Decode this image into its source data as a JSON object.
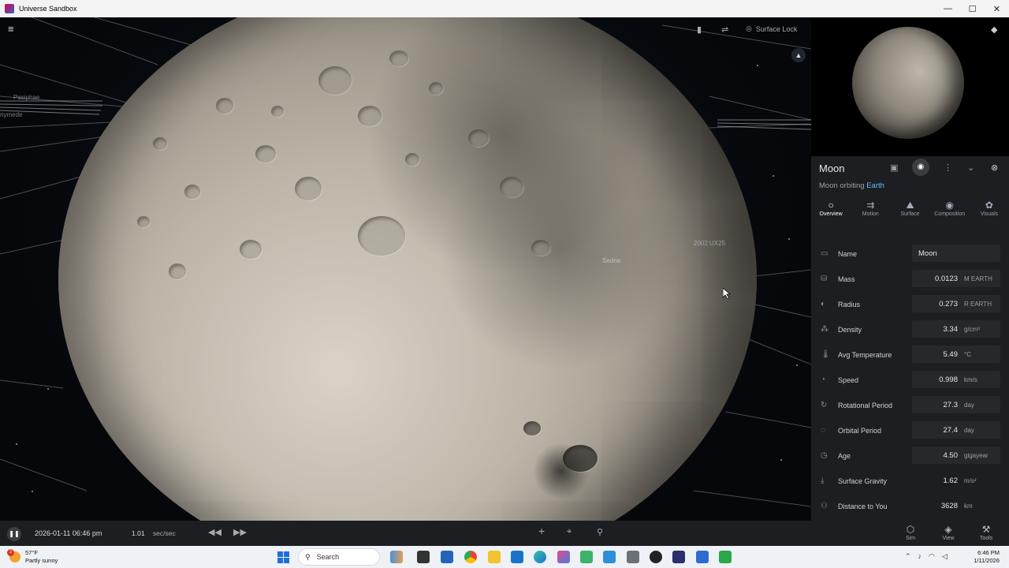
{
  "window": {
    "title": "Universe Sandbox",
    "controls": [
      "—",
      "☐",
      "✕"
    ]
  },
  "viewport": {
    "labels": [
      {
        "id": "pasiphae",
        "text": "Pasiphae"
      },
      {
        "id": "ganymede",
        "text": "nymede"
      },
      {
        "id": "sedna",
        "text": "Sedna"
      },
      {
        "id": "label-2002",
        "text": "2002 UX25"
      }
    ]
  },
  "toolbar": {
    "surface_lock_label": "Surface Lock"
  },
  "panel": {
    "object_name": "Moon",
    "orbiting_prefix": "Moon orbiting",
    "orbiting_target": "Earth",
    "tabs": [
      {
        "label": "Overview",
        "icon": "circle-icon",
        "glyph": "○"
      },
      {
        "label": "Motion",
        "icon": "motion-icon",
        "glyph": "⇉"
      },
      {
        "label": "Surface",
        "icon": "surface-icon",
        "glyph": "⛰"
      },
      {
        "label": "Composition",
        "icon": "composition-icon",
        "glyph": "◉"
      },
      {
        "label": "Visuals",
        "icon": "palette-icon",
        "glyph": "✿"
      }
    ],
    "properties": [
      {
        "label": "Name",
        "value": "Moon",
        "unit": "",
        "icon": "tag-icon",
        "glyph": "▭"
      },
      {
        "label": "Mass",
        "value": "0.0123",
        "unit": "M EARTH",
        "icon": "weight-icon",
        "glyph": "⛁"
      },
      {
        "label": "Radius",
        "value": "0.273",
        "unit": "R EARTH",
        "icon": "radius-icon",
        "glyph": "◐"
      },
      {
        "label": "Density",
        "value": "3.34",
        "unit": "g/cm³",
        "icon": "density-icon",
        "glyph": "⁂"
      },
      {
        "label": "Avg Temperature",
        "value": "5.49",
        "unit": "°C",
        "icon": "thermometer-icon",
        "glyph": "🌡"
      },
      {
        "label": "Speed",
        "value": "0.998",
        "unit": "km/s",
        "icon": "speed-icon",
        "glyph": "◔"
      },
      {
        "label": "Rotational Period",
        "value": "27.3",
        "unit": "day",
        "icon": "rotation-icon",
        "glyph": "↻"
      },
      {
        "label": "Orbital Period",
        "value": "27.4",
        "unit": "day",
        "icon": "orbit-icon",
        "glyph": "◌"
      },
      {
        "label": "Age",
        "value": "4.50",
        "unit": "gigayear",
        "icon": "clock-icon",
        "glyph": "◷"
      },
      {
        "label": "Surface Gravity",
        "value": "1.62",
        "unit": "m/s²",
        "icon": "gravity-icon",
        "glyph": "⤓"
      },
      {
        "label": "Distance to You",
        "value": "3628",
        "unit": "km",
        "icon": "distance-icon",
        "glyph": "⚇"
      }
    ]
  },
  "bottombar": {
    "datetime": "2026-01-11 06:46 pm",
    "speed_value": "1.01",
    "speed_unit": "sec/sec",
    "right_buttons": [
      {
        "label": "Sim",
        "icon": "cube-icon",
        "glyph": "⬡"
      },
      {
        "label": "View",
        "icon": "layers-icon",
        "glyph": "◈"
      },
      {
        "label": "Tools",
        "icon": "wrench-icon",
        "glyph": "⚒"
      }
    ]
  },
  "taskbar": {
    "weather_temp": "57°F",
    "weather_desc": "Partly sunny",
    "search_placeholder": "Search",
    "time": "6:46 PM",
    "date": "1/11/2026"
  }
}
